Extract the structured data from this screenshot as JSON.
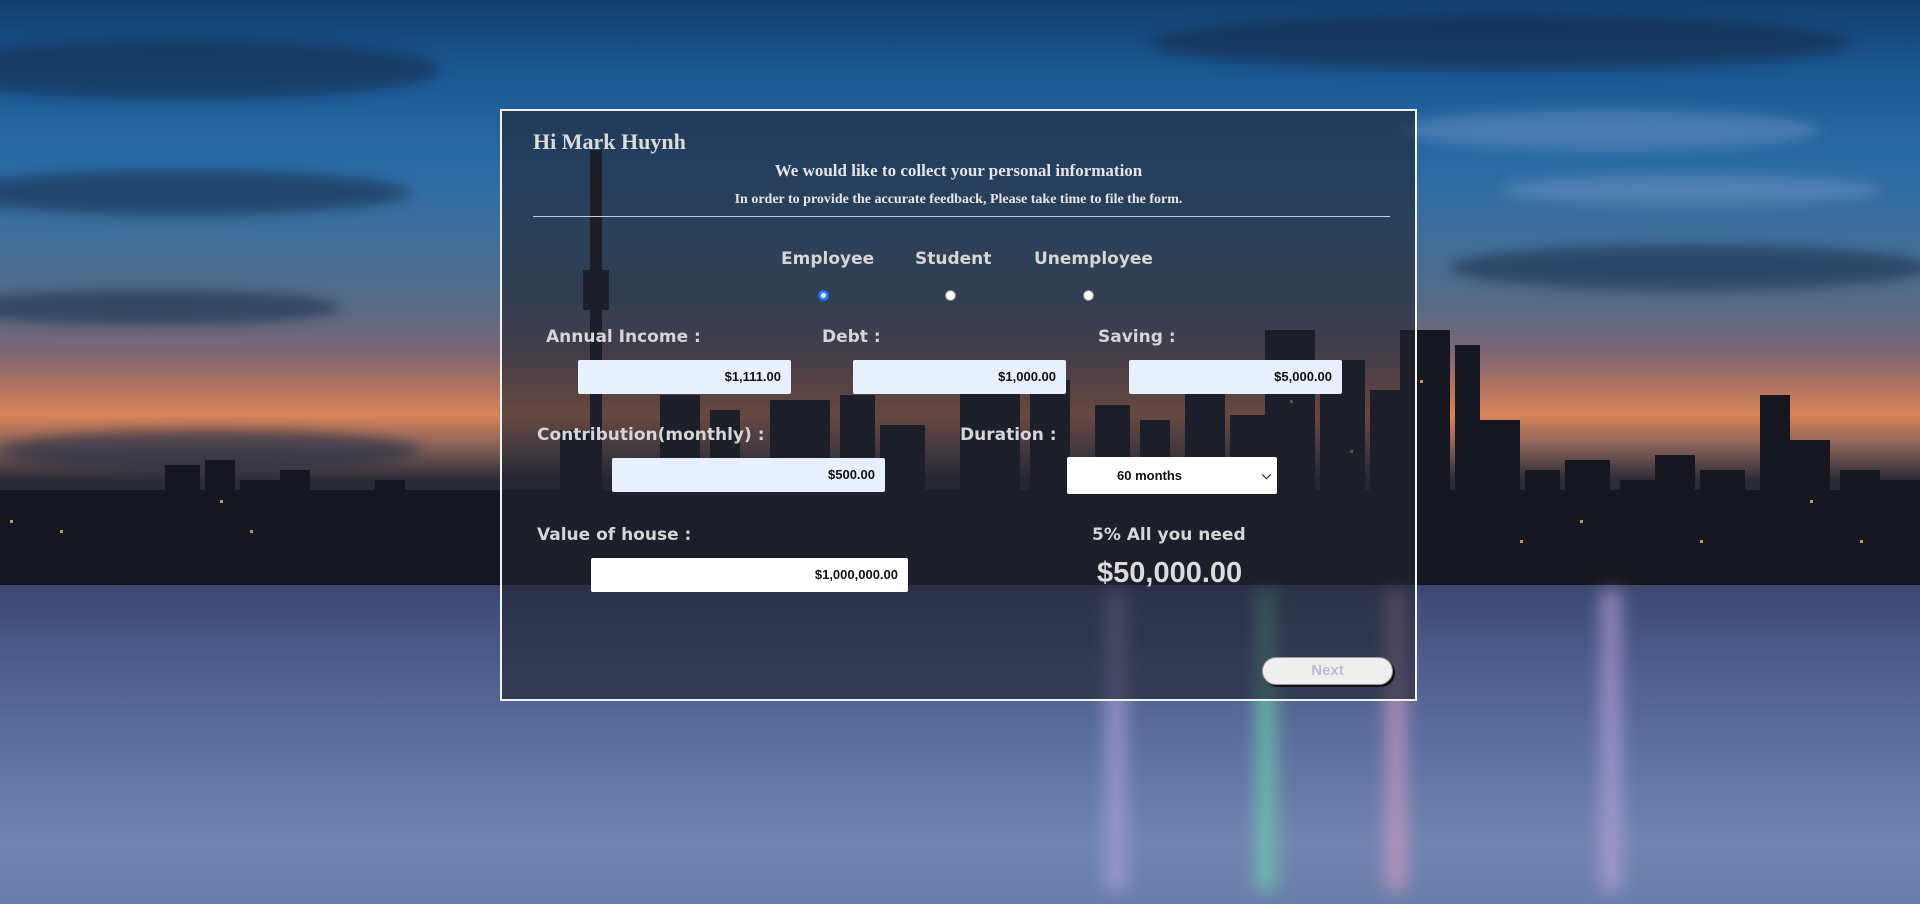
{
  "form": {
    "greeting": "Hi Mark Huynh",
    "heading": "We would like to collect your personal information",
    "subheading": "In order to provide the accurate feedback, Please take time to file the form.",
    "status_options": [
      {
        "label": "Employee",
        "checked": true
      },
      {
        "label": "Student",
        "checked": false
      },
      {
        "label": "Unemployee",
        "checked": false
      }
    ],
    "annual_income": {
      "label": "Annual Income :",
      "value": "$1,111.00"
    },
    "debt": {
      "label": "Debt :",
      "value": "$1,000.00"
    },
    "saving": {
      "label": "Saving :",
      "value": "$5,000.00"
    },
    "contribution": {
      "label": "Contribution(monthly) :",
      "value": "$500.00"
    },
    "duration": {
      "label": "Duration :",
      "selected": "60 months"
    },
    "house_value": {
      "label": "Value of house :",
      "value": "$1,000,000.00"
    },
    "need": {
      "label": "5% All you need",
      "value": "$50,000.00"
    },
    "next_label": "Next"
  },
  "colors": {
    "panel_border": "#f2f2f2",
    "input_autofill_bg": "#e8f0fe",
    "radio_checked": "#1a73e8"
  }
}
